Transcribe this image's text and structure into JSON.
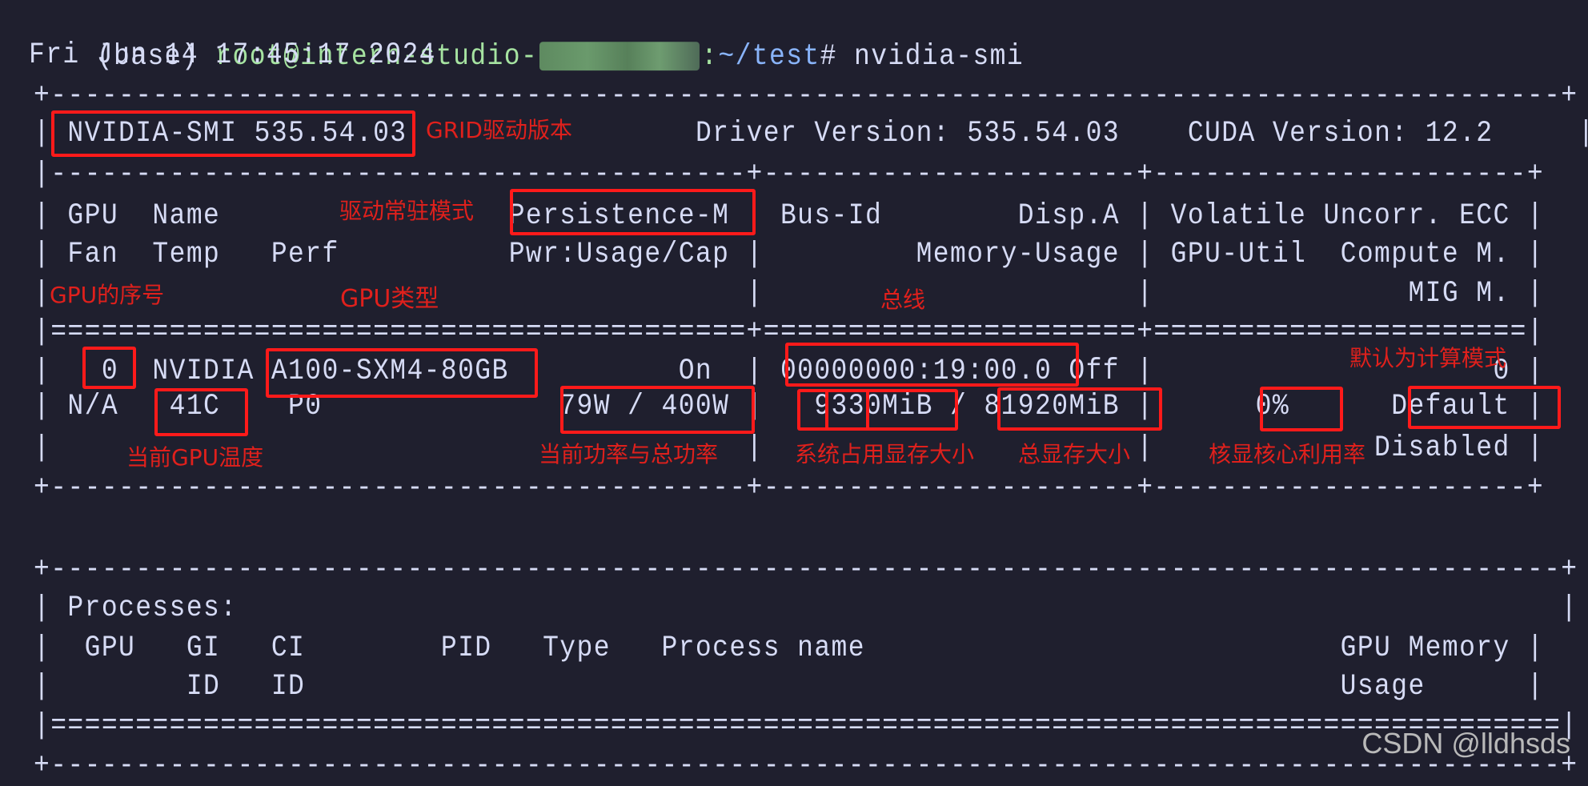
{
  "prompt": {
    "env": "(base)",
    "user_host": "root@intern-studio-",
    "host_redacted": true,
    "path": "~/test",
    "symbol": "#",
    "command": "nvidia-smi"
  },
  "timestamp": "Fri Jun 14 17:45:17 2024",
  "smi": {
    "border_top": "+-----------------------------------------------------------------------------------------+",
    "version_line": {
      "left": "| ",
      "smi_version": "NVIDIA-SMI 535.54.03",
      "middle": "                 Driver Version: 535.54.03    CUDA Version: 12.2     ",
      "right": "|"
    },
    "sep_header": "|-----------------------------------------+----------------------+----------------------+",
    "header_rows": [
      "| GPU  Name                 Persistence-M | Bus-Id        Disp.A | Volatile Uncorr. ECC |",
      "| Fan  Temp   Perf          Pwr:Usage/Cap |         Memory-Usage | GPU-Util  Compute M. |",
      "|                                         |                      |               MIG M. |"
    ],
    "sep_double": "|=========================================+======================+======================|",
    "gpu_rows": [
      "|   0  NVIDIA A100-SXM4-80GB          On  | 00000000:19:00.0 Off |                    0 |",
      "| N/A   41C    P0              79W / 400W |   9330MiB / 81920MiB |      0%      Default |",
      "|                                         |                      |             Disabled |"
    ],
    "border_mid": "+-----------------------------------------+----------------------+----------------------+",
    "processes": {
      "border_top": "+-----------------------------------------------------------------------------------------+",
      "title_row": "| Processes:                                                                              |",
      "header_rows": [
        "|  GPU   GI   CI        PID   Type   Process name                            GPU Memory |",
        "|        ID   ID                                                             Usage      |"
      ],
      "sep_double": "|=========================================================================================|",
      "border_bottom": "+-----------------------------------------------------------------------------------------+"
    }
  },
  "gpu": {
    "index": "0",
    "name": "NVIDIA A100-SXM4-80GB",
    "persistence_mode": "On",
    "bus_id": "00000000:19:00.0",
    "display_active": "Off",
    "volatile_uncorr_ecc": "0",
    "fan": "N/A",
    "temp": "41C",
    "perf": "P0",
    "power_usage": "79W",
    "power_cap": "400W",
    "memory_used": "9330MiB",
    "memory_total": "81920MiB",
    "gpu_util": "0%",
    "compute_mode": "Default",
    "mig_mode": "Disabled",
    "driver_version": "535.54.03",
    "cuda_version": "12.2"
  },
  "annotations": {
    "grid_driver_version": "GRID驱动版本",
    "persistence_mode": "驱动常驻模式",
    "gpu_index": "GPU的序号",
    "gpu_type": "GPU类型",
    "bus": "总线",
    "current_temp": "当前GPU温度",
    "power": "当前功率与总功率",
    "memory_used": "系统占用显存大小",
    "memory_total": "总显存大小",
    "gpu_util": "核显核心利用率",
    "compute_mode": "默认为计算模式"
  },
  "colors": {
    "background": "#1f1f2e",
    "text": "#d6dbf5",
    "prompt_user": "#a6e3a1",
    "prompt_path": "#89b4fa",
    "annotation_red": "#e0201c",
    "box_red": "#ff1a1a"
  },
  "watermark": "CSDN @lldhsds"
}
